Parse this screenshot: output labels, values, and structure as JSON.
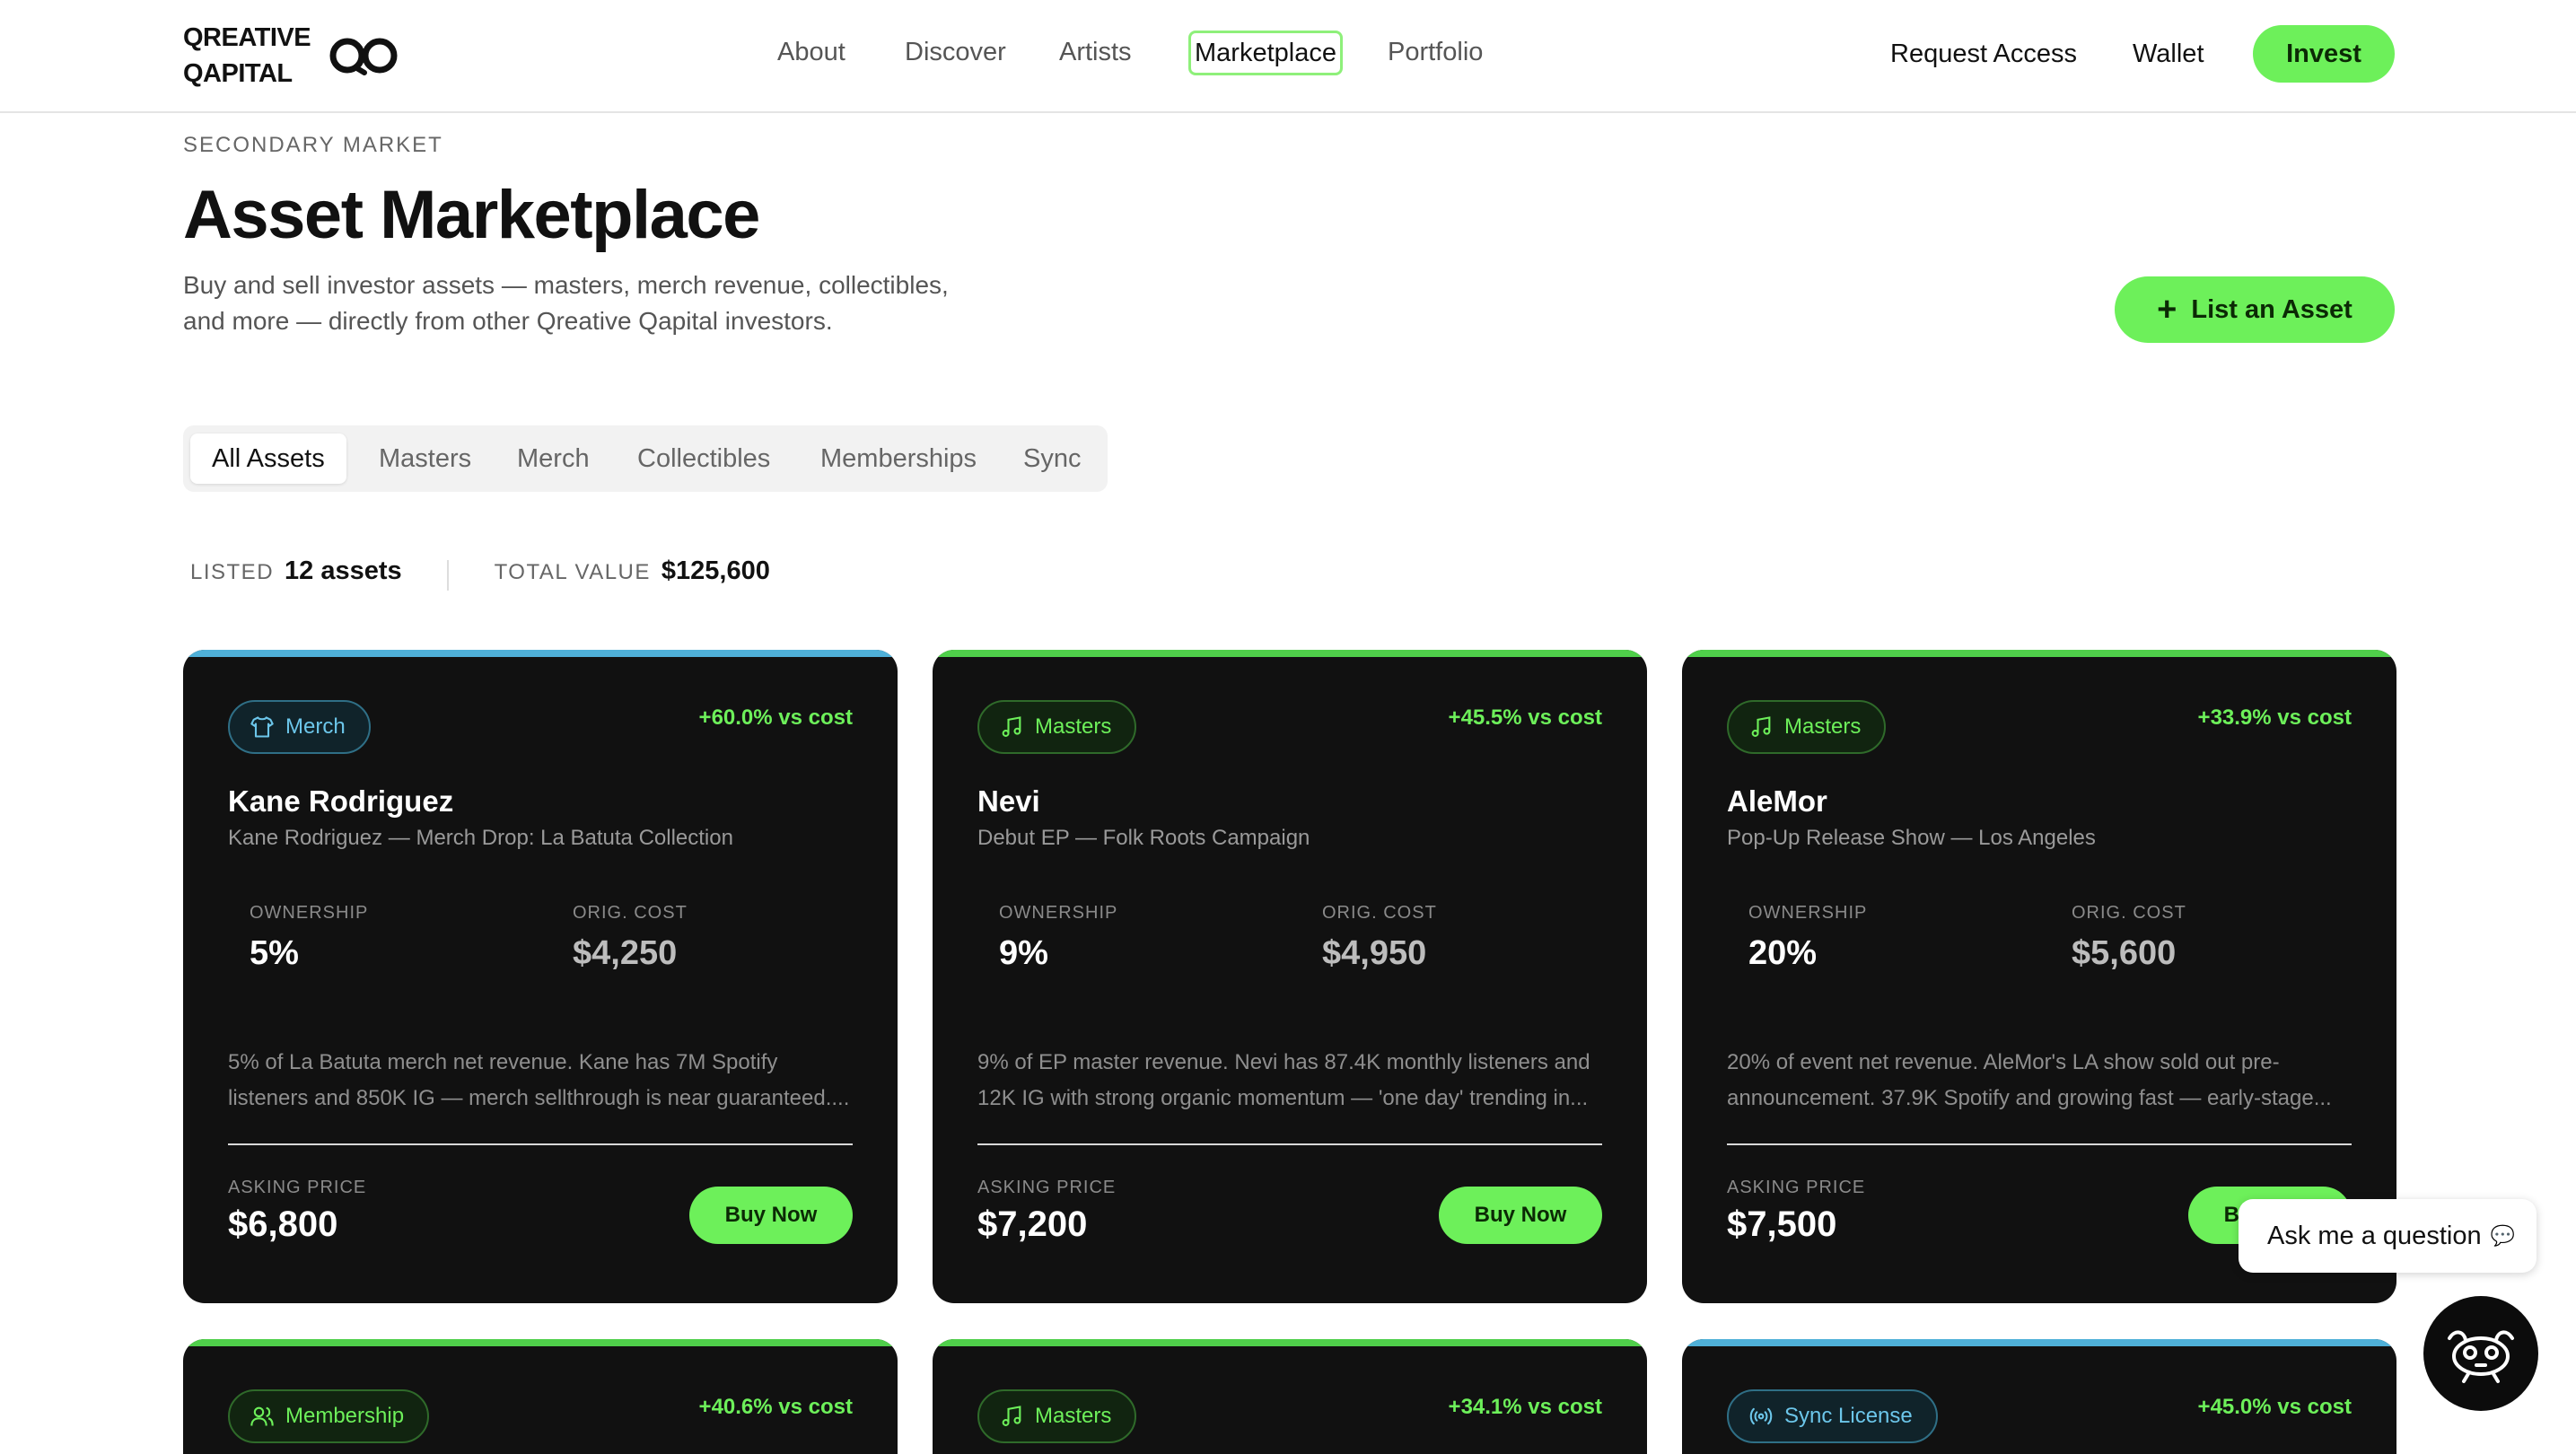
{
  "brand": {
    "line1": "QREATIVE",
    "line2": "QAPITAL"
  },
  "nav": {
    "links": [
      "About",
      "Discover",
      "Artists",
      "Marketplace",
      "Portfolio"
    ],
    "active": "Marketplace",
    "request_access": "Request Access",
    "wallet": "Wallet",
    "invest": "Invest"
  },
  "header": {
    "eyebrow": "SECONDARY MARKET",
    "title": "Asset Marketplace",
    "subtitle": "Buy and sell investor assets — masters, merch revenue, collectibles, and more — directly from other Qreative Qapital investors.",
    "list_button": "List an Asset"
  },
  "tabs": [
    "All Assets",
    "Masters",
    "Merch",
    "Collectibles",
    "Memberships",
    "Sync"
  ],
  "active_tab": "All Assets",
  "stats": {
    "listed_label": "LISTED",
    "listed_value": "12 assets",
    "total_label": "TOTAL VALUE",
    "total_value": "$125,600"
  },
  "card_labels": {
    "ownership": "OWNERSHIP",
    "orig_cost": "ORIG. COST",
    "asking_price": "ASKING PRICE",
    "buy": "Buy Now"
  },
  "cards": [
    {
      "category": "Merch",
      "icon": "shirt-icon",
      "accent": "#4fb0d8",
      "gain": "+60.0% vs cost",
      "artist": "Kane Rodriguez",
      "project": "Kane Rodriguez — Merch Drop: La Batuta Collection",
      "ownership": "5%",
      "orig_cost": "$4,250",
      "description": "5% of La Batuta merch net revenue. Kane has 7M Spotify listeners and 850K IG — merch sellthrough is near guaranteed....",
      "asking_price": "$6,800"
    },
    {
      "category": "Masters",
      "icon": "music-note-icon",
      "accent": "#4fcf4a",
      "gain": "+45.5% vs cost",
      "artist": "Nevi",
      "project": "Debut EP — Folk Roots Campaign",
      "ownership": "9%",
      "orig_cost": "$4,950",
      "description": "9% of EP master revenue. Nevi has 87.4K monthly listeners and 12K IG with strong organic momentum — 'one day' trending in...",
      "asking_price": "$7,200"
    },
    {
      "category": "Masters",
      "icon": "music-note-icon",
      "accent": "#4fcf4a",
      "gain": "+33.9% vs cost",
      "artist": "AleMor",
      "project": "Pop-Up Release Show — Los Angeles",
      "ownership": "20%",
      "orig_cost": "$5,600",
      "description": "20% of event net revenue. AleMor's LA show sold out pre-announcement. 37.9K Spotify and growing fast — early-stage...",
      "asking_price": "$7,500"
    },
    {
      "category": "Membership",
      "icon": "users-icon",
      "accent": "#4fcf4a",
      "gain": "+40.6% vs cost"
    },
    {
      "category": "Masters",
      "icon": "music-note-icon",
      "accent": "#4fcf4a",
      "gain": "+34.1% vs cost"
    },
    {
      "category": "Sync License",
      "icon": "broadcast-icon",
      "accent": "#4fb0d8",
      "gain": "+45.0% vs cost"
    }
  ],
  "chat": {
    "prompt": "Ask me a question"
  }
}
